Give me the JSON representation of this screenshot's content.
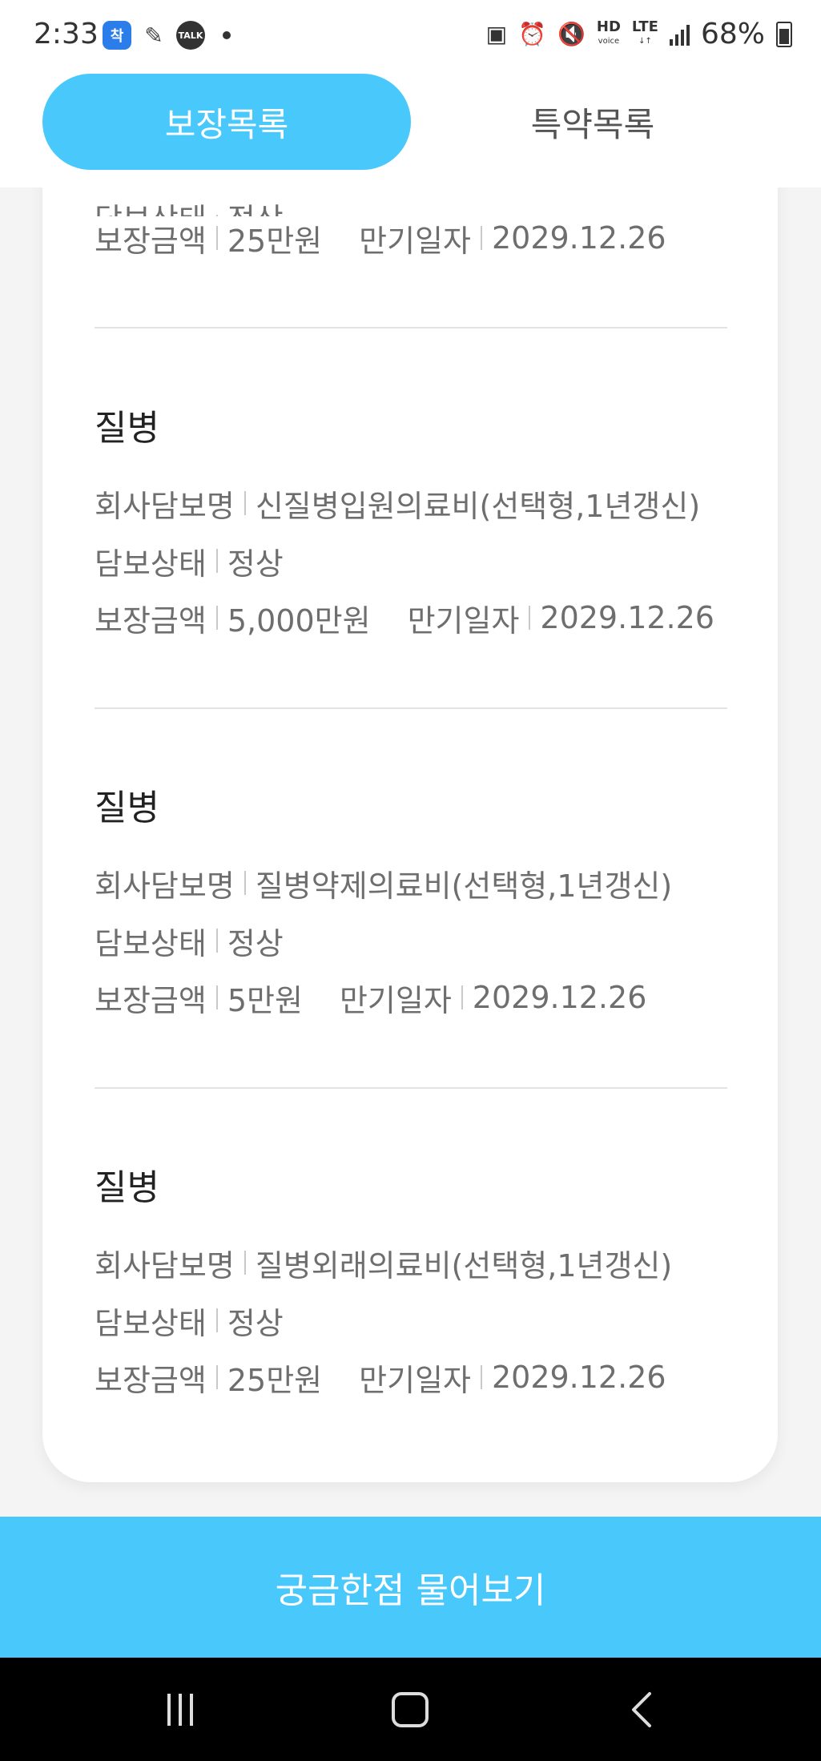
{
  "status_bar": {
    "time": "2:33",
    "app_icon_1": "착",
    "talk_icon": "TALK",
    "hd_label": "HD",
    "hd_sub": "voice",
    "lte_label": "LTE",
    "battery_percent": "68%"
  },
  "tabs": {
    "coverage_list": "보장목록",
    "rider_list": "특약목록"
  },
  "labels": {
    "company_coverage_name": "회사담보명",
    "coverage_status": "담보상태",
    "coverage_amount": "보장금액",
    "maturity_date": "만기일자"
  },
  "top_partial": {
    "status_value": "정상",
    "amount": "25만원",
    "maturity": "2029.12.26"
  },
  "items": [
    {
      "category": "질병",
      "company_coverage_name": "신질병입원의료비(선택형,1년갱신)",
      "status": "정상",
      "amount": "5,000만원",
      "maturity": "2029.12.26"
    },
    {
      "category": "질병",
      "company_coverage_name": "질병약제의료비(선택형,1년갱신)",
      "status": "정상",
      "amount": "5만원",
      "maturity": "2029.12.26"
    },
    {
      "category": "질병",
      "company_coverage_name": "질병외래의료비(선택형,1년갱신)",
      "status": "정상",
      "amount": "25만원",
      "maturity": "2029.12.26"
    }
  ],
  "ask_button": "궁금한점 물어보기",
  "colors": {
    "accent": "#48c8fb",
    "text_muted": "#6e6e6e",
    "background": "#f4f4f5"
  }
}
